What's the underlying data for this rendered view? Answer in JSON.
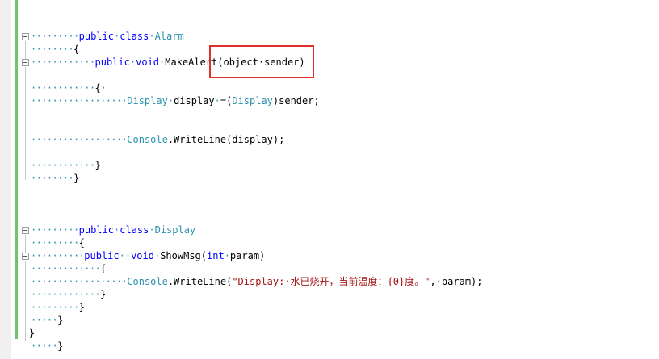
{
  "editor": {
    "lines": {
      "l1": {
        "indent": "·········",
        "parts": [
          [
            "kw",
            "public"
          ],
          [
            "dot",
            "·"
          ],
          [
            "kw",
            "class"
          ],
          [
            "dot",
            "·"
          ],
          [
            "ty",
            "Alarm"
          ]
        ]
      },
      "l2": {
        "indent": "········",
        "parts": [
          [
            "txt",
            "{"
          ]
        ]
      },
      "l3": {
        "indent": "············",
        "parts": [
          [
            "kw",
            "public"
          ],
          [
            "dot",
            "·"
          ],
          [
            "kw",
            "void"
          ],
          [
            "dot",
            "·"
          ],
          [
            "txt",
            "MakeAlert(object·sender)"
          ]
        ]
      },
      "l4": {
        "indent": "············",
        "parts": [
          [
            "txt",
            "{"
          ],
          [
            "dot",
            "·"
          ]
        ]
      },
      "l5": {
        "indent": "··················",
        "parts": [
          [
            "ty",
            "Display"
          ],
          [
            "dot",
            "·"
          ],
          [
            "txt",
            "display"
          ],
          [
            "dot",
            "·"
          ],
          [
            "txt",
            "=("
          ],
          [
            "ty",
            "Display"
          ],
          [
            "txt",
            ")sender;"
          ]
        ]
      },
      "l6": {
        "indent": "··················",
        "parts": [
          [
            "ty",
            "Console"
          ],
          [
            "txt",
            ".WriteLine(display);"
          ]
        ]
      },
      "l7": {
        "indent": "············",
        "parts": [
          [
            "txt",
            "}"
          ]
        ]
      },
      "l8": {
        "indent": "········",
        "parts": [
          [
            "txt",
            "}"
          ]
        ]
      },
      "l9": {
        "indent": "·········",
        "parts": [
          [
            "kw",
            "public"
          ],
          [
            "dot",
            "·"
          ],
          [
            "kw",
            "class"
          ],
          [
            "dot",
            "·"
          ],
          [
            "ty",
            "Display"
          ]
        ]
      },
      "l10": {
        "indent": "·········",
        "parts": [
          [
            "txt",
            "{"
          ]
        ]
      },
      "l11": {
        "indent": "··········",
        "parts": [
          [
            "kw",
            "public"
          ],
          [
            "dot",
            "··"
          ],
          [
            "kw",
            "void"
          ],
          [
            "dot",
            "·"
          ],
          [
            "txt",
            "ShowMsg("
          ],
          [
            "kw",
            "int"
          ],
          [
            "dot",
            "·"
          ],
          [
            "txt",
            "param)"
          ]
        ]
      },
      "l12": {
        "indent": "·············",
        "parts": [
          [
            "txt",
            "{"
          ]
        ]
      },
      "l13": {
        "indent": "··················",
        "parts": [
          [
            "ty",
            "Console"
          ],
          [
            "txt",
            ".WriteLine("
          ],
          [
            "str",
            "\"Display:·水已烧开，当前温度：{0}度。\""
          ],
          [
            "txt",
            ",·param);"
          ]
        ]
      },
      "l14": {
        "indent": "·············",
        "parts": [
          [
            "txt",
            "}"
          ]
        ]
      },
      "l15": {
        "indent": "·········",
        "parts": [
          [
            "txt",
            "}"
          ]
        ]
      },
      "l16": {
        "indent": "·····",
        "parts": [
          [
            "txt",
            "}"
          ]
        ]
      },
      "l17": {
        "indent": "",
        "parts": [
          [
            "txt",
            "}"
          ]
        ]
      },
      "l18": {
        "indent": "·····",
        "parts": [
          [
            "txt",
            "}"
          ]
        ]
      }
    },
    "highlight_color": "#e0302a",
    "gutter_color": "#6cc46c"
  }
}
